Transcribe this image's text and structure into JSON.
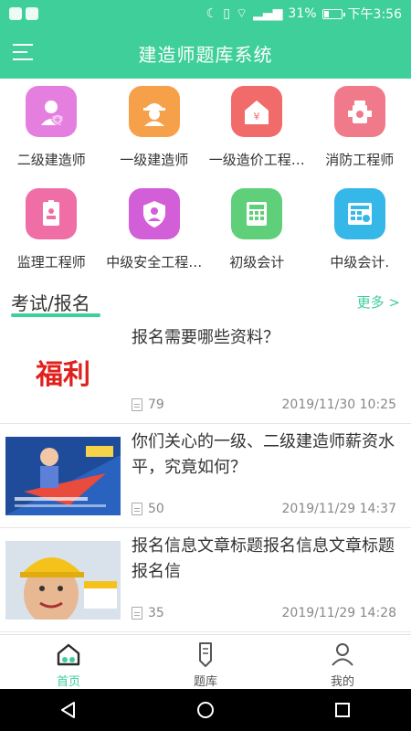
{
  "status_bar": {
    "battery": "31%",
    "battery_level": 0.31,
    "time": "下午3:56"
  },
  "appbar": {
    "title": "建造师题库系统"
  },
  "categories": [
    {
      "label": "二级建造师",
      "color": "#e47fe0",
      "icon": "worker-shield-icon"
    },
    {
      "label": "一级建造师",
      "color": "#f7a04a",
      "icon": "worker-helmet-icon"
    },
    {
      "label": "一级造价工程…",
      "color": "#f26b6b",
      "icon": "price-house-icon"
    },
    {
      "label": "消防工程师",
      "color": "#f07a8a",
      "icon": "hydrant-icon"
    },
    {
      "label": "监理工程师",
      "color": "#f06ea6",
      "icon": "badge-icon"
    },
    {
      "label": "中级安全工程…",
      "color": "#d25ed8",
      "icon": "safety-shield-icon"
    },
    {
      "label": "初级会计",
      "color": "#5fcf7a",
      "icon": "calculator-icon"
    },
    {
      "label": "中级会计.",
      "color": "#35b8e8",
      "icon": "accounting-grid-icon"
    }
  ],
  "section": {
    "title": "考试/报名",
    "more": "更多 >"
  },
  "articles": [
    {
      "title": "报名需要哪些资料？",
      "thumb_text": "福利",
      "views": "79",
      "date": "2019/11/30 10:25"
    },
    {
      "title": "你们关心的一级、二级建造师薪资水平，究竟如何？",
      "views": "50",
      "date": "2019/11/29 14:37"
    },
    {
      "title": "报名信息文章标题报名信息文章标题报名信",
      "views": "35",
      "date": "2019/11/29 14:28"
    }
  ],
  "tabs": [
    {
      "label": "首页",
      "active": true
    },
    {
      "label": "题库",
      "active": false
    },
    {
      "label": "我的",
      "active": false
    }
  ],
  "colors": {
    "primary": "#3ecf9a",
    "text": "#333333",
    "muted": "#888888"
  }
}
